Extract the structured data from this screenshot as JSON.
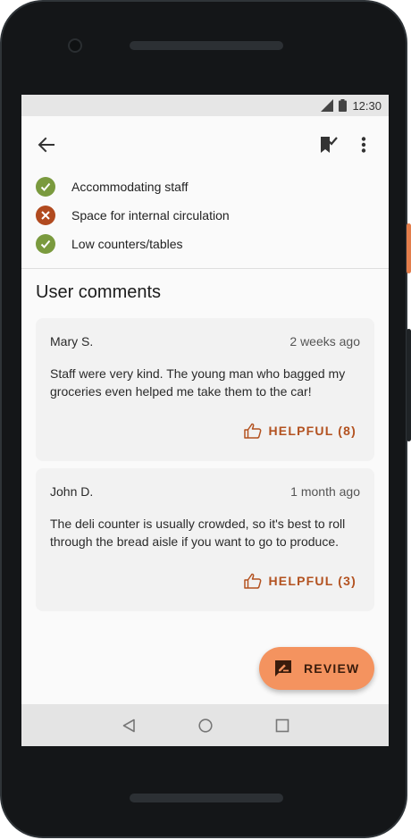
{
  "status_bar": {
    "time": "12:30",
    "icons": [
      "signal-icon",
      "battery-icon"
    ]
  },
  "app_bar": {
    "icons": [
      "back-arrow-icon",
      "bookmark-check-icon",
      "more-vert-icon"
    ]
  },
  "features": [
    {
      "label": "Accommodating staff",
      "status": "yes",
      "icon": "check-circle-icon",
      "color": "#7a9a3e"
    },
    {
      "label": "Space for internal circulation",
      "status": "no",
      "icon": "cancel-circle-icon",
      "color": "#b14a1f"
    },
    {
      "label": "Low counters/tables",
      "status": "yes",
      "icon": "check-circle-icon",
      "color": "#7a9a3e"
    }
  ],
  "comments_section": {
    "title": "User comments"
  },
  "comments": [
    {
      "author": "Mary S.",
      "time": "2 weeks ago",
      "text": "Staff were very kind. The young man who bagged my groceries even helped me take them to the car!",
      "helpful_label": "HELPFUL (8)"
    },
    {
      "author": "John D.",
      "time": "1 month ago",
      "text": "The deli counter is usually crowded, so it's best to roll through the bread aisle if you want to go to produce.",
      "helpful_label": "HELPFUL (3)"
    }
  ],
  "fab": {
    "label": "REVIEW",
    "icon": "rate-review-icon",
    "color": "#f4935f"
  },
  "nav_bar": {
    "icons": [
      "nav-back-icon",
      "nav-home-icon",
      "nav-recents-icon"
    ]
  },
  "colors": {
    "accent": "#b35220",
    "positive": "#7a9a3e",
    "negative": "#b14a1f"
  }
}
